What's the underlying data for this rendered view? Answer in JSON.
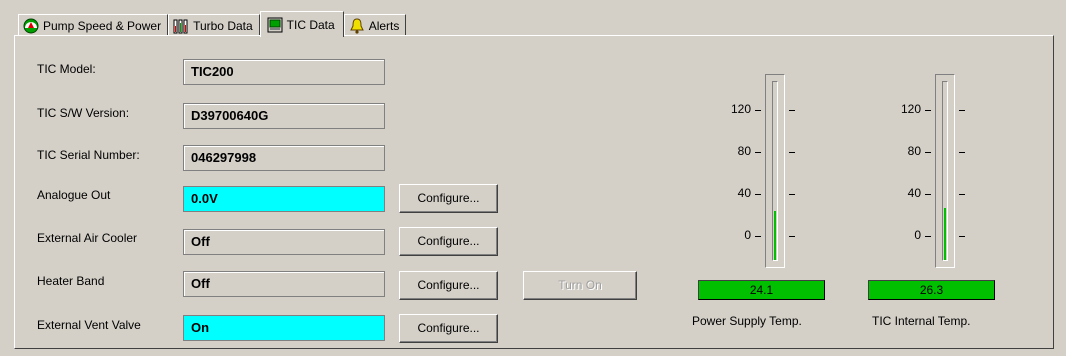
{
  "tabs": [
    {
      "label": "Pump Speed & Power",
      "icon": "gauge-icon"
    },
    {
      "label": "Turbo Data",
      "icon": "bar-meter-icon"
    },
    {
      "label": "TIC Data",
      "icon": "monitor-icon"
    },
    {
      "label": "Alerts",
      "icon": "bell-icon"
    }
  ],
  "fields": {
    "tic_model": {
      "label": "TIC Model:",
      "value": "TIC200"
    },
    "sw_version": {
      "label": "TIC S/W Version:",
      "value": "D39700640G"
    },
    "serial_number": {
      "label": "TIC Serial Number:",
      "value": "046297998"
    },
    "analogue_out": {
      "label": "Analogue Out",
      "value": "0.0V",
      "button": "Configure..."
    },
    "air_cooler": {
      "label": "External Air Cooler",
      "value": "Off",
      "button": "Configure..."
    },
    "heater_band": {
      "label": "Heater Band",
      "value": "Off",
      "button": "Configure...",
      "action": "Turn On"
    },
    "vent_valve": {
      "label": "External Vent Valve",
      "value": "On",
      "button": "Configure..."
    }
  },
  "gauges": {
    "ticks": [
      "120",
      "80",
      "40",
      "0"
    ],
    "power_supply": {
      "label": "Power Supply Temp.",
      "value": "24.1",
      "level": 24.1
    },
    "tic_internal": {
      "label": "TIC Internal Temp.",
      "value": "26.3",
      "level": 26.3
    },
    "scale_min": -20,
    "scale_max": 140
  },
  "colors": {
    "active_field": "#00ffff",
    "gauge_fill": "#00c000",
    "background": "#d4d0c8"
  }
}
